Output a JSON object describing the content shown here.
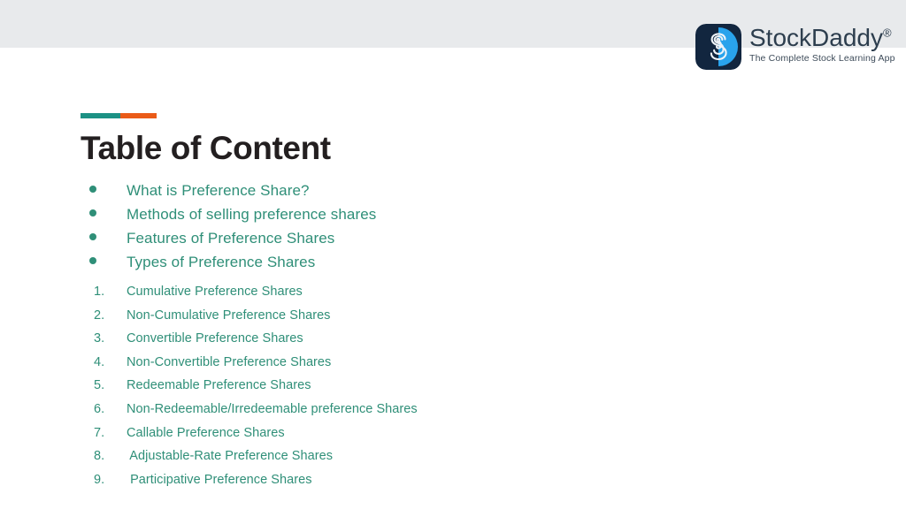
{
  "header": {
    "band_color": "#e8eaec",
    "brand": {
      "logo_icon": "stockdaddy-s-logo-icon",
      "name": "StockDaddy",
      "registered_mark": "®",
      "tagline": "The Complete Stock Learning App",
      "name_color": "#2d3e4e",
      "logo_navy": "#12263f",
      "logo_blue": "#29a3ec"
    }
  },
  "title_block": {
    "accent_teal_color": "#1c9184",
    "accent_orange_color": "#ea5b18",
    "title": "Table of Content"
  },
  "content": {
    "accent_color": "#2f8f78",
    "bullets": [
      {
        "label": "What is Preference Share?"
      },
      {
        "label": "Methods of selling preference shares"
      },
      {
        "label": "Features of Preference Shares"
      },
      {
        "label": "Types of Preference Shares"
      }
    ],
    "numbered": [
      {
        "index": "1.",
        "label": "Cumulative Preference Shares"
      },
      {
        "index": "2.",
        "label": "Non-Cumulative Preference Shares"
      },
      {
        "index": "3.",
        "label": "Convertible Preference Shares"
      },
      {
        "index": "4.",
        "label": "Non-Convertible Preference Shares"
      },
      {
        "index": "5.",
        "label": "Redeemable Preference Shares"
      },
      {
        "index": "6.",
        "label": "Non-Redeemable/Irredeemable preference Shares"
      },
      {
        "index": "7.",
        "label": "Callable Preference Shares"
      },
      {
        "index": "8.",
        "label": " Adjustable-Rate Preference Shares"
      },
      {
        "index": "9.",
        "label": " Participative Preference Shares"
      }
    ]
  }
}
